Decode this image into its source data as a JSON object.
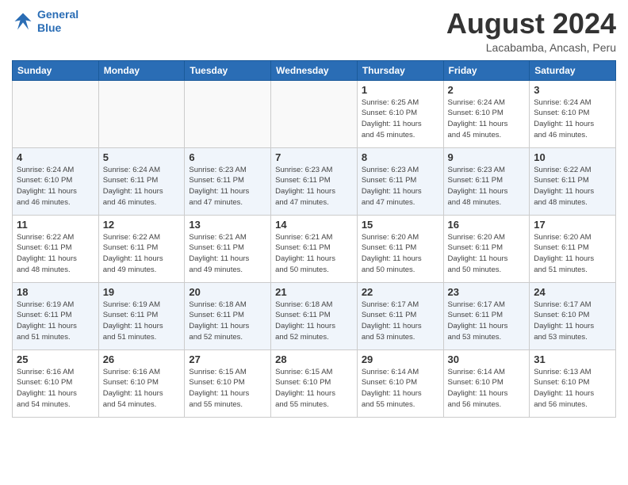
{
  "header": {
    "logo_line1": "General",
    "logo_line2": "Blue",
    "month_year": "August 2024",
    "location": "Lacabamba, Ancash, Peru"
  },
  "weekdays": [
    "Sunday",
    "Monday",
    "Tuesday",
    "Wednesday",
    "Thursday",
    "Friday",
    "Saturday"
  ],
  "weeks": [
    [
      {
        "day": "",
        "info": ""
      },
      {
        "day": "",
        "info": ""
      },
      {
        "day": "",
        "info": ""
      },
      {
        "day": "",
        "info": ""
      },
      {
        "day": "1",
        "info": "Sunrise: 6:25 AM\nSunset: 6:10 PM\nDaylight: 11 hours\nand 45 minutes."
      },
      {
        "day": "2",
        "info": "Sunrise: 6:24 AM\nSunset: 6:10 PM\nDaylight: 11 hours\nand 45 minutes."
      },
      {
        "day": "3",
        "info": "Sunrise: 6:24 AM\nSunset: 6:10 PM\nDaylight: 11 hours\nand 46 minutes."
      }
    ],
    [
      {
        "day": "4",
        "info": "Sunrise: 6:24 AM\nSunset: 6:10 PM\nDaylight: 11 hours\nand 46 minutes."
      },
      {
        "day": "5",
        "info": "Sunrise: 6:24 AM\nSunset: 6:11 PM\nDaylight: 11 hours\nand 46 minutes."
      },
      {
        "day": "6",
        "info": "Sunrise: 6:23 AM\nSunset: 6:11 PM\nDaylight: 11 hours\nand 47 minutes."
      },
      {
        "day": "7",
        "info": "Sunrise: 6:23 AM\nSunset: 6:11 PM\nDaylight: 11 hours\nand 47 minutes."
      },
      {
        "day": "8",
        "info": "Sunrise: 6:23 AM\nSunset: 6:11 PM\nDaylight: 11 hours\nand 47 minutes."
      },
      {
        "day": "9",
        "info": "Sunrise: 6:23 AM\nSunset: 6:11 PM\nDaylight: 11 hours\nand 48 minutes."
      },
      {
        "day": "10",
        "info": "Sunrise: 6:22 AM\nSunset: 6:11 PM\nDaylight: 11 hours\nand 48 minutes."
      }
    ],
    [
      {
        "day": "11",
        "info": "Sunrise: 6:22 AM\nSunset: 6:11 PM\nDaylight: 11 hours\nand 48 minutes."
      },
      {
        "day": "12",
        "info": "Sunrise: 6:22 AM\nSunset: 6:11 PM\nDaylight: 11 hours\nand 49 minutes."
      },
      {
        "day": "13",
        "info": "Sunrise: 6:21 AM\nSunset: 6:11 PM\nDaylight: 11 hours\nand 49 minutes."
      },
      {
        "day": "14",
        "info": "Sunrise: 6:21 AM\nSunset: 6:11 PM\nDaylight: 11 hours\nand 50 minutes."
      },
      {
        "day": "15",
        "info": "Sunrise: 6:20 AM\nSunset: 6:11 PM\nDaylight: 11 hours\nand 50 minutes."
      },
      {
        "day": "16",
        "info": "Sunrise: 6:20 AM\nSunset: 6:11 PM\nDaylight: 11 hours\nand 50 minutes."
      },
      {
        "day": "17",
        "info": "Sunrise: 6:20 AM\nSunset: 6:11 PM\nDaylight: 11 hours\nand 51 minutes."
      }
    ],
    [
      {
        "day": "18",
        "info": "Sunrise: 6:19 AM\nSunset: 6:11 PM\nDaylight: 11 hours\nand 51 minutes."
      },
      {
        "day": "19",
        "info": "Sunrise: 6:19 AM\nSunset: 6:11 PM\nDaylight: 11 hours\nand 51 minutes."
      },
      {
        "day": "20",
        "info": "Sunrise: 6:18 AM\nSunset: 6:11 PM\nDaylight: 11 hours\nand 52 minutes."
      },
      {
        "day": "21",
        "info": "Sunrise: 6:18 AM\nSunset: 6:11 PM\nDaylight: 11 hours\nand 52 minutes."
      },
      {
        "day": "22",
        "info": "Sunrise: 6:17 AM\nSunset: 6:11 PM\nDaylight: 11 hours\nand 53 minutes."
      },
      {
        "day": "23",
        "info": "Sunrise: 6:17 AM\nSunset: 6:11 PM\nDaylight: 11 hours\nand 53 minutes."
      },
      {
        "day": "24",
        "info": "Sunrise: 6:17 AM\nSunset: 6:10 PM\nDaylight: 11 hours\nand 53 minutes."
      }
    ],
    [
      {
        "day": "25",
        "info": "Sunrise: 6:16 AM\nSunset: 6:10 PM\nDaylight: 11 hours\nand 54 minutes."
      },
      {
        "day": "26",
        "info": "Sunrise: 6:16 AM\nSunset: 6:10 PM\nDaylight: 11 hours\nand 54 minutes."
      },
      {
        "day": "27",
        "info": "Sunrise: 6:15 AM\nSunset: 6:10 PM\nDaylight: 11 hours\nand 55 minutes."
      },
      {
        "day": "28",
        "info": "Sunrise: 6:15 AM\nSunset: 6:10 PM\nDaylight: 11 hours\nand 55 minutes."
      },
      {
        "day": "29",
        "info": "Sunrise: 6:14 AM\nSunset: 6:10 PM\nDaylight: 11 hours\nand 55 minutes."
      },
      {
        "day": "30",
        "info": "Sunrise: 6:14 AM\nSunset: 6:10 PM\nDaylight: 11 hours\nand 56 minutes."
      },
      {
        "day": "31",
        "info": "Sunrise: 6:13 AM\nSunset: 6:10 PM\nDaylight: 11 hours\nand 56 minutes."
      }
    ]
  ]
}
